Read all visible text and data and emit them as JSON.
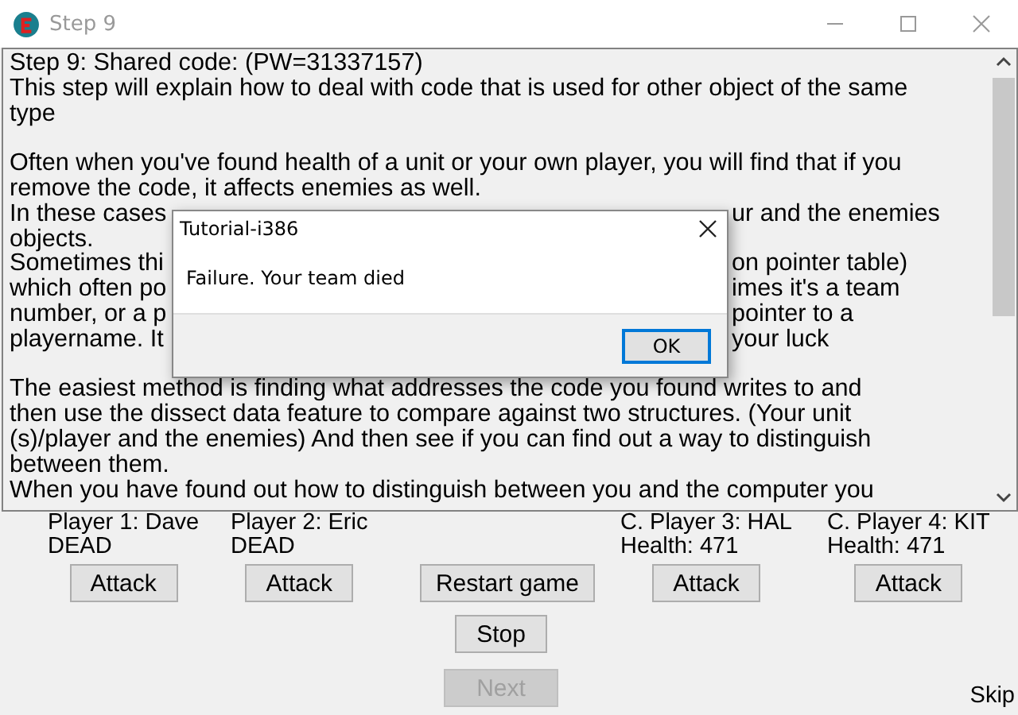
{
  "window": {
    "title": "Step 9"
  },
  "text_lines": [
    {
      "kind": "line",
      "text": "Step 9: Shared code: (PW=31337157)"
    },
    {
      "kind": "line",
      "text": "This step will explain how to deal with code that is used for other object of the same"
    },
    {
      "kind": "line",
      "text": "type"
    },
    {
      "kind": "blank"
    },
    {
      "kind": "line",
      "text": "Often when you've found health of a unit or your own player, you will find that if you"
    },
    {
      "kind": "line",
      "text": "remove the code, it affects enemies as well."
    },
    {
      "kind": "split",
      "left": "In these cases",
      "right": "ur and the enemies"
    },
    {
      "kind": "line",
      "text": "objects."
    },
    {
      "kind": "split",
      "left": "Sometimes thi",
      "right": "on pointer table)"
    },
    {
      "kind": "split",
      "left": "which often po",
      "right": "imes it's a team"
    },
    {
      "kind": "split",
      "left": "number, or a p",
      "right": "pointer to a"
    },
    {
      "kind": "split",
      "left": "playername. It",
      "right": "your luck"
    },
    {
      "kind": "blank"
    },
    {
      "kind": "line",
      "text": "The easiest method is finding what addresses the code you found writes to and"
    },
    {
      "kind": "line",
      "text": "then use the dissect data feature to compare against two structures. (Your unit"
    },
    {
      "kind": "line",
      "text": "(s)/player and the enemies) And then see if you can find out a way to distinguish"
    },
    {
      "kind": "line",
      "text": "between them."
    },
    {
      "kind": "line",
      "text": "When you have found out how to distinguish between you and the computer you"
    }
  ],
  "players": [
    {
      "name": "Player 1: Dave",
      "status": "DEAD",
      "button": "Attack"
    },
    {
      "name": "Player 2: Eric",
      "status": "DEAD",
      "button": "Attack"
    },
    {
      "name": "C. Player 3: HAL",
      "status": "Health: 471",
      "button": "Attack"
    },
    {
      "name": "C. Player 4: KIT",
      "status": "Health: 471",
      "button": "Attack"
    }
  ],
  "restart_button": {
    "label": "Restart game",
    "disabled": false
  },
  "stop_button": {
    "label": "Stop",
    "disabled": false
  },
  "next_button": {
    "label": "Next",
    "disabled": true
  },
  "skip_link": "Skip",
  "dialog": {
    "title": "Tutorial-i386",
    "message": "Failure. Your team died",
    "button": "OK"
  }
}
